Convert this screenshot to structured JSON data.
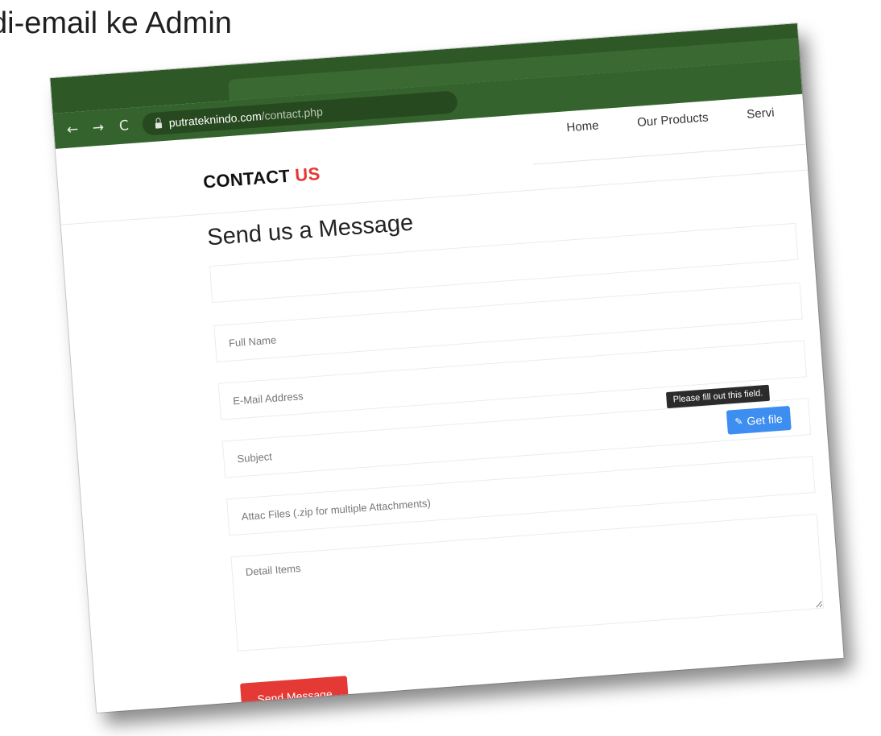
{
  "slide": {
    "caption": "di-email ke Admin"
  },
  "browser": {
    "back_icon": "←",
    "forward_icon": "→",
    "reload_icon": "C",
    "url_domain": "putrateknindo.com",
    "url_path": "/contact.php"
  },
  "site": {
    "logo_main": "CONTACT ",
    "logo_accent": "US",
    "logo_accent_color": "#e53935",
    "nav": [
      "Home",
      "Our Products",
      "Servi"
    ]
  },
  "form": {
    "title": "Send us a Message",
    "full_name_placeholder": "Full Name",
    "email_placeholder": "E-Mail Address",
    "subject_placeholder": "Subject",
    "attach_placeholder": "Attac Files (.zip for multiple Attachments)",
    "detail_placeholder": "Detail Items",
    "tooltip": "Please fill out this field.",
    "get_file_label": "Get file",
    "get_file_icon": "paperclip-icon",
    "send_label": "Send Message",
    "send_color": "#e53935",
    "get_file_color": "#3d8ef0"
  }
}
